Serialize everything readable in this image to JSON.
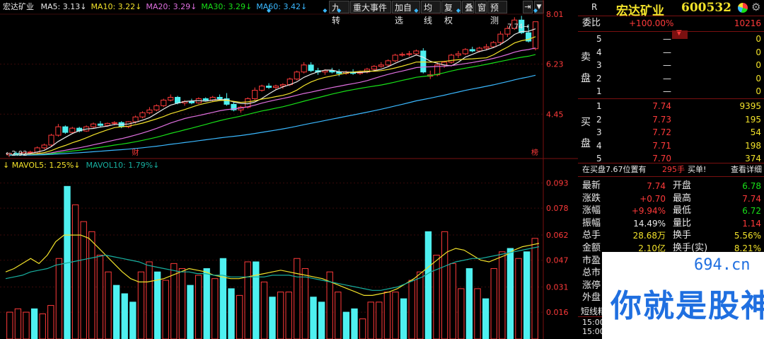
{
  "stock": {
    "name": "宏达矿业",
    "code": "600532",
    "flag": "R"
  },
  "ma_legend": [
    {
      "label": "MA5: 3.13",
      "arrow": "↓",
      "color": "#e8e8e8"
    },
    {
      "label": "MA10: 3.22",
      "arrow": "↓",
      "color": "#f2e22a"
    },
    {
      "label": "MA20: 3.29",
      "arrow": "↓",
      "color": "#e070e0"
    },
    {
      "label": "MA30: 3.29",
      "arrow": "↓",
      "color": "#18e018"
    },
    {
      "label": "MA60: 3.42",
      "arrow": "↓",
      "color": "#3ab8ff"
    }
  ],
  "toolbar": [
    "九转",
    "重大事件",
    "加自选",
    "均线",
    "复权",
    "叠",
    "窗",
    "预测"
  ],
  "price_axis": [
    "8.01",
    "6.23",
    "4.45"
  ],
  "price_labels": {
    "high": "7.74",
    "low": "2.92",
    "marker_fin": "财",
    "marker_bang": "榜"
  },
  "vol_legend": [
    {
      "label": "MAVOL5: 1.25%",
      "arrow": "↓",
      "color": "#f2e22a"
    },
    {
      "label": "MAVOL10: 1.79%",
      "arrow": "↓",
      "color": "#18b0a0"
    }
  ],
  "vol_axis": [
    "0.093",
    "0.078",
    "0.062",
    "0.047",
    "0.031",
    "0.016"
  ],
  "order_book": {
    "weibi_label": "委比",
    "weibi_value": "+100.00%",
    "weicha_value": "10216",
    "sell_side_label": [
      "卖",
      "盘"
    ],
    "buy_side_label": [
      "买",
      "盘"
    ],
    "sells": [
      {
        "level": "5",
        "price": "—",
        "vol": "0"
      },
      {
        "level": "4",
        "price": "—",
        "vol": "0"
      },
      {
        "level": "3",
        "price": "—",
        "vol": "0"
      },
      {
        "level": "2",
        "price": "—",
        "vol": "0"
      },
      {
        "level": "1",
        "price": "—",
        "vol": "0"
      }
    ],
    "buys": [
      {
        "level": "1",
        "price": "7.74",
        "vol": "9395"
      },
      {
        "level": "2",
        "price": "7.73",
        "vol": "195"
      },
      {
        "level": "3",
        "price": "7.72",
        "vol": "54"
      },
      {
        "level": "4",
        "price": "7.71",
        "vol": "198"
      },
      {
        "level": "5",
        "price": "7.70",
        "vol": "374"
      }
    ]
  },
  "notice": {
    "text": "在买盘7.67位置有",
    "qty": "295手",
    "action": "买单!",
    "link": "查看详细"
  },
  "stats": [
    {
      "l1": "最新",
      "v1": "7.74",
      "c1": "red",
      "l2": "开盘",
      "v2": "6.78",
      "c2": "green"
    },
    {
      "l1": "涨跌",
      "v1": "+0.70",
      "c1": "red",
      "l2": "最高",
      "v2": "7.74",
      "c2": "red"
    },
    {
      "l1": "涨幅",
      "v1": "+9.94%",
      "c1": "red",
      "l2": "最低",
      "v2": "6.72",
      "c2": "green"
    },
    {
      "l1": "振幅",
      "v1": "14.49%",
      "c1": "white",
      "l2": "量比",
      "v2": "1.14",
      "c2": "red"
    },
    {
      "l1": "总手",
      "v1": "28.68万",
      "c1": "yellow",
      "l2": "换手",
      "v2": "5.56%",
      "c2": "yellow"
    },
    {
      "l1": "金额",
      "v1": "2.10亿",
      "c1": "yellow",
      "l2": "换手(实)",
      "v2": "8.21%",
      "c2": "yellow"
    },
    {
      "l1": "市盈",
      "v1": "",
      "c1": "white",
      "l2": "",
      "v2": "",
      "c2": "white"
    },
    {
      "l1": "总市",
      "v1": "",
      "c1": "white",
      "l2": "",
      "v2": "",
      "c2": "white"
    },
    {
      "l1": "涨停",
      "v1": "",
      "c1": "white",
      "l2": "",
      "v2": "",
      "c2": "white"
    },
    {
      "l1": "外盘",
      "v1": "",
      "c1": "white",
      "l2": "",
      "v2": "",
      "c2": "white"
    }
  ],
  "bottom_tab": "短线精",
  "ticks": [
    "15:00",
    "15:00"
  ],
  "watermark": {
    "domain": "694.cn",
    "slogan": "你就是股神"
  },
  "colors": {
    "up": "#ff3a3a",
    "down": "#4ef0f0",
    "grid": "#7a1010",
    "bg": "#000000"
  },
  "chart_data": [
    {
      "type": "candlestick",
      "title": "宏达矿业",
      "ylim": [
        2.92,
        8.01
      ],
      "y_ticks": [
        8.01,
        6.23,
        4.45
      ],
      "candles": [
        {
          "o": 3.0,
          "h": 3.08,
          "l": 2.92,
          "c": 3.05
        },
        {
          "o": 3.05,
          "h": 3.12,
          "l": 3.0,
          "c": 3.03
        },
        {
          "o": 3.03,
          "h": 3.1,
          "l": 2.98,
          "c": 3.08
        },
        {
          "o": 3.08,
          "h": 3.15,
          "l": 3.02,
          "c": 3.1
        },
        {
          "o": 3.1,
          "h": 3.3,
          "l": 3.05,
          "c": 3.25
        },
        {
          "o": 3.25,
          "h": 3.4,
          "l": 3.2,
          "c": 3.35
        },
        {
          "o": 3.35,
          "h": 3.75,
          "l": 3.3,
          "c": 3.7
        },
        {
          "o": 3.7,
          "h": 4.1,
          "l": 3.65,
          "c": 4.0
        },
        {
          "o": 4.0,
          "h": 4.05,
          "l": 3.75,
          "c": 3.8
        },
        {
          "o": 3.8,
          "h": 4.0,
          "l": 3.75,
          "c": 3.95
        },
        {
          "o": 3.95,
          "h": 4.0,
          "l": 3.8,
          "c": 3.85
        },
        {
          "o": 3.85,
          "h": 4.05,
          "l": 3.82,
          "c": 4.0
        },
        {
          "o": 4.0,
          "h": 4.15,
          "l": 3.95,
          "c": 4.1
        },
        {
          "o": 4.1,
          "h": 4.2,
          "l": 4.0,
          "c": 4.05
        },
        {
          "o": 4.05,
          "h": 4.15,
          "l": 4.0,
          "c": 4.12
        },
        {
          "o": 4.12,
          "h": 4.2,
          "l": 4.05,
          "c": 4.15
        },
        {
          "o": 4.15,
          "h": 4.2,
          "l": 3.95,
          "c": 4.0
        },
        {
          "o": 4.0,
          "h": 4.2,
          "l": 3.95,
          "c": 4.18
        },
        {
          "o": 4.18,
          "h": 4.4,
          "l": 4.12,
          "c": 4.35
        },
        {
          "o": 4.35,
          "h": 4.55,
          "l": 4.3,
          "c": 4.5
        },
        {
          "o": 4.5,
          "h": 4.7,
          "l": 4.45,
          "c": 4.6
        },
        {
          "o": 4.6,
          "h": 4.8,
          "l": 4.55,
          "c": 4.75
        },
        {
          "o": 4.75,
          "h": 5.0,
          "l": 4.7,
          "c": 4.95
        },
        {
          "o": 4.95,
          "h": 5.15,
          "l": 4.9,
          "c": 5.05
        },
        {
          "o": 5.05,
          "h": 5.1,
          "l": 4.8,
          "c": 4.85
        },
        {
          "o": 4.85,
          "h": 4.95,
          "l": 4.75,
          "c": 4.9
        },
        {
          "o": 4.9,
          "h": 5.0,
          "l": 4.8,
          "c": 4.85
        },
        {
          "o": 4.85,
          "h": 5.05,
          "l": 4.82,
          "c": 5.0
        },
        {
          "o": 5.0,
          "h": 5.05,
          "l": 4.9,
          "c": 4.95
        },
        {
          "o": 4.95,
          "h": 5.1,
          "l": 4.9,
          "c": 5.05
        },
        {
          "o": 5.05,
          "h": 5.15,
          "l": 4.95,
          "c": 5.0
        },
        {
          "o": 5.0,
          "h": 5.2,
          "l": 4.75,
          "c": 4.8
        },
        {
          "o": 4.8,
          "h": 4.9,
          "l": 4.55,
          "c": 4.6
        },
        {
          "o": 4.6,
          "h": 4.75,
          "l": 4.5,
          "c": 4.7
        },
        {
          "o": 4.7,
          "h": 5.05,
          "l": 4.65,
          "c": 5.0
        },
        {
          "o": 5.0,
          "h": 5.4,
          "l": 4.95,
          "c": 5.3
        },
        {
          "o": 5.3,
          "h": 5.5,
          "l": 5.25,
          "c": 5.45
        },
        {
          "o": 5.45,
          "h": 5.55,
          "l": 5.35,
          "c": 5.4
        },
        {
          "o": 5.4,
          "h": 5.5,
          "l": 5.3,
          "c": 5.45
        },
        {
          "o": 5.45,
          "h": 5.55,
          "l": 5.35,
          "c": 5.5
        },
        {
          "o": 5.5,
          "h": 5.75,
          "l": 5.45,
          "c": 5.7
        },
        {
          "o": 5.7,
          "h": 6.0,
          "l": 5.65,
          "c": 5.95
        },
        {
          "o": 5.95,
          "h": 6.3,
          "l": 5.9,
          "c": 6.2
        },
        {
          "o": 6.2,
          "h": 6.3,
          "l": 5.95,
          "c": 6.0
        },
        {
          "o": 6.0,
          "h": 6.1,
          "l": 5.85,
          "c": 5.95
        },
        {
          "o": 5.95,
          "h": 6.05,
          "l": 5.85,
          "c": 6.0
        },
        {
          "o": 6.0,
          "h": 6.1,
          "l": 5.9,
          "c": 5.95
        },
        {
          "o": 5.95,
          "h": 6.05,
          "l": 5.8,
          "c": 5.9
        },
        {
          "o": 5.9,
          "h": 6.0,
          "l": 5.85,
          "c": 5.95
        },
        {
          "o": 5.95,
          "h": 6.05,
          "l": 5.85,
          "c": 5.9
        },
        {
          "o": 5.9,
          "h": 6.0,
          "l": 5.85,
          "c": 5.95
        },
        {
          "o": 5.95,
          "h": 6.1,
          "l": 5.9,
          "c": 6.05
        },
        {
          "o": 6.05,
          "h": 6.2,
          "l": 6.0,
          "c": 6.15
        },
        {
          "o": 6.15,
          "h": 6.3,
          "l": 6.1,
          "c": 6.2
        },
        {
          "o": 6.2,
          "h": 6.4,
          "l": 6.15,
          "c": 6.35
        },
        {
          "o": 6.35,
          "h": 6.6,
          "l": 6.3,
          "c": 6.55
        },
        {
          "o": 6.55,
          "h": 6.65,
          "l": 6.5,
          "c": 6.58
        },
        {
          "o": 6.58,
          "h": 6.7,
          "l": 6.5,
          "c": 6.6
        },
        {
          "o": 6.6,
          "h": 6.75,
          "l": 6.55,
          "c": 6.7
        },
        {
          "o": 6.7,
          "h": 6.8,
          "l": 5.9,
          "c": 5.95
        },
        {
          "o": 5.8,
          "h": 6.0,
          "l": 5.7,
          "c": 5.85
        },
        {
          "o": 5.85,
          "h": 6.3,
          "l": 5.8,
          "c": 6.2
        },
        {
          "o": 6.2,
          "h": 6.35,
          "l": 6.1,
          "c": 6.3
        },
        {
          "o": 6.3,
          "h": 6.6,
          "l": 6.25,
          "c": 6.55
        },
        {
          "o": 6.55,
          "h": 6.7,
          "l": 6.45,
          "c": 6.6
        },
        {
          "o": 6.6,
          "h": 6.8,
          "l": 6.55,
          "c": 6.75
        },
        {
          "o": 6.75,
          "h": 6.85,
          "l": 6.65,
          "c": 6.7
        },
        {
          "o": 6.7,
          "h": 6.85,
          "l": 6.65,
          "c": 6.8
        },
        {
          "o": 6.8,
          "h": 6.95,
          "l": 6.72,
          "c": 6.85
        },
        {
          "o": 6.85,
          "h": 7.05,
          "l": 6.8,
          "c": 7.0
        },
        {
          "o": 7.0,
          "h": 7.4,
          "l": 6.9,
          "c": 7.3
        },
        {
          "o": 7.3,
          "h": 7.6,
          "l": 7.2,
          "c": 7.5
        },
        {
          "o": 7.5,
          "h": 7.9,
          "l": 7.45,
          "c": 7.8
        },
        {
          "o": 7.8,
          "h": 7.95,
          "l": 7.3,
          "c": 7.35
        },
        {
          "o": 7.35,
          "h": 7.65,
          "l": 7.0,
          "c": 7.05
        },
        {
          "o": 6.78,
          "h": 7.74,
          "l": 6.72,
          "c": 7.74
        }
      ]
    },
    {
      "type": "bar",
      "title": "MAVOL",
      "ylim": [
        0,
        0.1
      ],
      "y_ticks": [
        0.093,
        0.078,
        0.062,
        0.047,
        0.031,
        0.016
      ],
      "series": [
        {
          "name": "MAVOL5",
          "values": [
            0.04,
            0.042,
            0.045,
            0.048,
            0.045,
            0.05,
            0.058,
            0.062,
            0.062,
            0.062,
            0.06,
            0.055,
            0.05,
            0.045,
            0.04,
            0.036,
            0.034,
            0.034,
            0.035,
            0.036,
            0.038,
            0.04,
            0.042,
            0.041,
            0.04,
            0.038,
            0.037,
            0.036,
            0.036,
            0.037,
            0.038,
            0.039,
            0.04,
            0.041,
            0.04,
            0.039,
            0.038,
            0.037,
            0.036,
            0.034,
            0.032,
            0.03,
            0.028,
            0.026,
            0.026,
            0.027,
            0.028,
            0.03,
            0.033,
            0.036,
            0.04,
            0.044,
            0.048,
            0.052,
            0.054,
            0.053,
            0.05,
            0.047,
            0.046,
            0.048,
            0.05,
            0.053,
            0.055,
            0.056,
            0.057
          ]
        },
        {
          "name": "MAVOL10",
          "values": [
            0.036,
            0.037,
            0.038,
            0.04,
            0.041,
            0.042,
            0.044,
            0.045,
            0.046,
            0.047,
            0.048,
            0.049,
            0.05,
            0.049,
            0.048,
            0.047,
            0.046,
            0.044,
            0.043,
            0.042,
            0.041,
            0.04,
            0.04,
            0.039,
            0.039,
            0.038,
            0.038,
            0.037,
            0.037,
            0.037,
            0.037,
            0.037,
            0.038,
            0.038,
            0.038,
            0.037,
            0.037,
            0.036,
            0.035,
            0.034,
            0.033,
            0.032,
            0.031,
            0.03,
            0.029,
            0.029,
            0.03,
            0.031,
            0.033,
            0.035,
            0.037,
            0.04,
            0.042,
            0.044,
            0.046,
            0.047,
            0.048,
            0.048,
            0.049,
            0.05,
            0.051,
            0.052,
            0.053,
            0.054,
            0.055
          ]
        }
      ],
      "bars": [
        {
          "v": 0.016,
          "up": 1
        },
        {
          "v": 0.018,
          "up": 1
        },
        {
          "v": 0.016,
          "up": 1
        },
        {
          "v": 0.018,
          "up": 0
        },
        {
          "v": 0.015,
          "up": 1
        },
        {
          "v": 0.02,
          "up": 1
        },
        {
          "v": 0.048,
          "up": 1
        },
        {
          "v": 0.091,
          "up": 0
        },
        {
          "v": 0.08,
          "up": 1
        },
        {
          "v": 0.07,
          "up": 1
        },
        {
          "v": 0.064,
          "up": 1
        },
        {
          "v": 0.05,
          "up": 1
        },
        {
          "v": 0.04,
          "up": 1
        },
        {
          "v": 0.032,
          "up": 0
        },
        {
          "v": 0.027,
          "up": 0
        },
        {
          "v": 0.022,
          "up": 0
        },
        {
          "v": 0.04,
          "up": 1
        },
        {
          "v": 0.046,
          "up": 1
        },
        {
          "v": 0.04,
          "up": 0
        },
        {
          "v": 0.035,
          "up": 1
        },
        {
          "v": 0.045,
          "up": 1
        },
        {
          "v": 0.042,
          "up": 1
        },
        {
          "v": 0.032,
          "up": 0
        },
        {
          "v": 0.038,
          "up": 1
        },
        {
          "v": 0.042,
          "up": 0
        },
        {
          "v": 0.036,
          "up": 1
        },
        {
          "v": 0.048,
          "up": 0
        },
        {
          "v": 0.03,
          "up": 0
        },
        {
          "v": 0.026,
          "up": 1
        },
        {
          "v": 0.046,
          "up": 1
        },
        {
          "v": 0.046,
          "up": 0
        },
        {
          "v": 0.034,
          "up": 1
        },
        {
          "v": 0.025,
          "up": 0
        },
        {
          "v": 0.028,
          "up": 1
        },
        {
          "v": 0.028,
          "up": 1
        },
        {
          "v": 0.048,
          "up": 1
        },
        {
          "v": 0.042,
          "up": 1
        },
        {
          "v": 0.025,
          "up": 0
        },
        {
          "v": 0.022,
          "up": 0
        },
        {
          "v": 0.04,
          "up": 1
        },
        {
          "v": 0.028,
          "up": 1
        },
        {
          "v": 0.016,
          "up": 0
        },
        {
          "v": 0.018,
          "up": 0
        },
        {
          "v": 0.012,
          "up": 1
        },
        {
          "v": 0.022,
          "up": 1
        },
        {
          "v": 0.022,
          "up": 1
        },
        {
          "v": 0.028,
          "up": 1
        },
        {
          "v": 0.028,
          "up": 1
        },
        {
          "v": 0.024,
          "up": 0
        },
        {
          "v": 0.035,
          "up": 1
        },
        {
          "v": 0.04,
          "up": 1
        },
        {
          "v": 0.064,
          "up": 0
        },
        {
          "v": 0.05,
          "up": 1
        },
        {
          "v": 0.064,
          "up": 1
        },
        {
          "v": 0.045,
          "up": 1
        },
        {
          "v": 0.03,
          "up": 1
        },
        {
          "v": 0.042,
          "up": 0
        },
        {
          "v": 0.03,
          "up": 1
        },
        {
          "v": 0.024,
          "up": 0
        },
        {
          "v": 0.042,
          "up": 1
        },
        {
          "v": 0.052,
          "up": 1
        },
        {
          "v": 0.054,
          "up": 0
        },
        {
          "v": 0.048,
          "up": 1
        },
        {
          "v": 0.052,
          "up": 0
        },
        {
          "v": 0.06,
          "up": 1
        }
      ]
    }
  ]
}
